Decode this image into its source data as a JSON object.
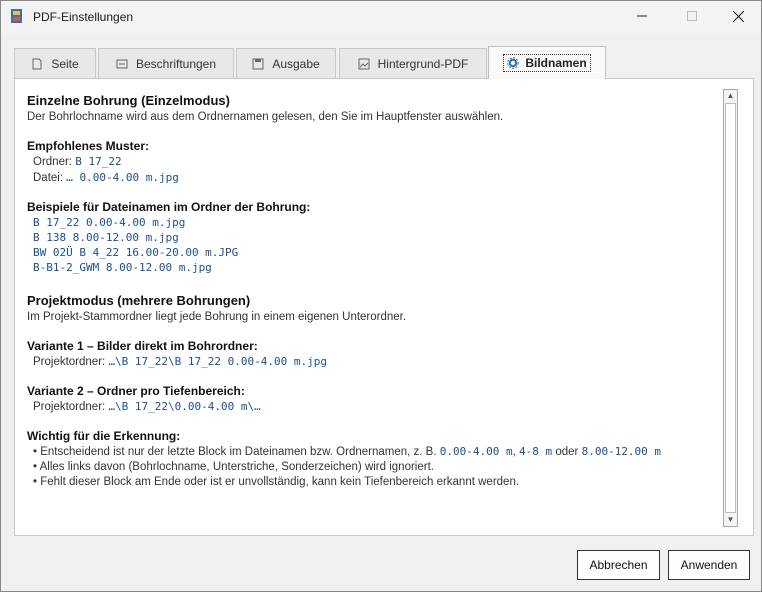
{
  "window": {
    "title": "PDF-Einstellungen"
  },
  "tabs": [
    {
      "label": "Seite",
      "icon": "page-icon"
    },
    {
      "label": "Beschriftungen",
      "icon": "label-icon"
    },
    {
      "label": "Ausgabe",
      "icon": "save-icon"
    },
    {
      "label": "Hintergrund-PDF",
      "icon": "image-icon"
    },
    {
      "label": "Bildnamen",
      "icon": "gear-icon",
      "active": true
    }
  ],
  "content": {
    "single": {
      "heading": "Einzelne Bohrung (Einzelmodus)",
      "desc": "Der Bohrlochname wird aus dem Ordnernamen gelesen, den Sie im Hauptfenster auswählen."
    },
    "pattern": {
      "heading": "Empfohlenes Muster:",
      "folder_label": "Ordner:",
      "folder_value": "B 17_22",
      "file_label": "Datei:",
      "file_value": "… 0.00-4.00 m.jpg"
    },
    "examples": {
      "heading": "Beispiele für Dateinamen im Ordner der Bohrung:",
      "items": [
        "B 17_22 0.00-4.00 m.jpg",
        "B 138 8.00-12.00 m.jpg",
        "BW 02Ü B 4_22 16.00-20.00 m.JPG",
        "B-B1-2_GWM 8.00-12.00 m.jpg"
      ]
    },
    "project": {
      "heading": "Projektmodus (mehrere Bohrungen)",
      "desc": "Im Projekt-Stammordner liegt jede Bohrung in einem eigenen Unterordner."
    },
    "variant1": {
      "heading": "Variante 1 – Bilder direkt im Bohrordner:",
      "label": "Projektordner:",
      "value": "…\\B 17_22\\B 17_22 0.00-4.00 m.jpg"
    },
    "variant2": {
      "heading": "Variante 2 – Ordner pro Tiefenbereich:",
      "label": "Projektordner:",
      "value": "…\\B 17_22\\0.00-4.00 m\\…"
    },
    "important": {
      "heading": "Wichtig für die Erkennung:",
      "b1_text": "Entscheidend ist nur der letzte Block im Dateinamen bzw. Ordnernamen, z. B.",
      "b1_code1": "0.00-4.00 m",
      "b1_sep": ",",
      "b1_code2": "4-8 m",
      "b1_or": "oder",
      "b1_code3": "8.00-12.00 m",
      "b2": "Alles links davon (Bohrlochname, Unterstriche, Sonderzeichen) wird ignoriert.",
      "b3": "Fehlt dieser Block am Ende oder ist er unvollständig, kann kein Tiefenbereich erkannt werden."
    }
  },
  "buttons": {
    "cancel": "Abbrechen",
    "apply": "Anwenden"
  }
}
